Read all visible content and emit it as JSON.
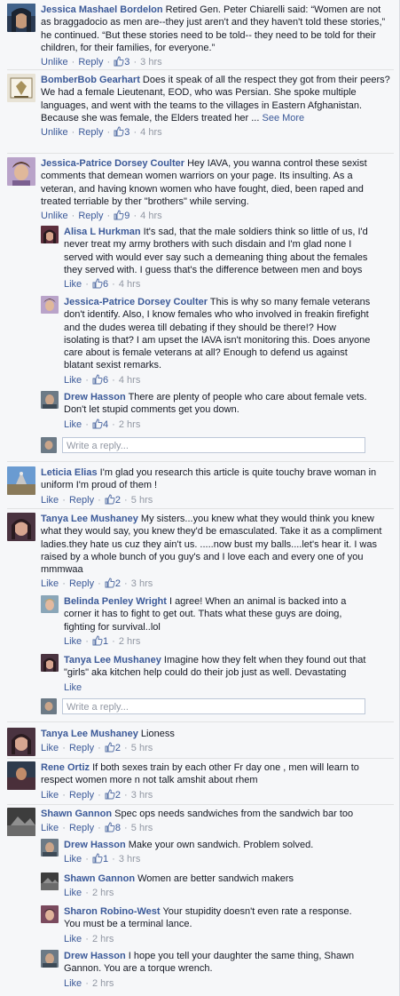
{
  "reply_placeholder": "Write a reply...",
  "see_more_label": "See More",
  "colors": {
    "link": "#3b5998",
    "meta": "#9197a3",
    "text": "#141823",
    "panel": "#f6f7f9"
  },
  "comments": [
    {
      "name": "Jessica Mashael Bordelon",
      "text": "Retired Gen. Peter Chiarelli said: “Women are not as braggadocio as men are--they just aren't and they haven't told these stories,” he continued. “But these stories need to be told-- they need to be told for their children, for their families, for everyone.”",
      "action1": "Unlike",
      "reply": "Reply",
      "likes": "3",
      "time": "3 hrs"
    },
    {
      "name": "BomberBob Gearhart",
      "text": "Does it speak of all the respect they got from their peers? We had a female Lieutenant, EOD, who was Persian. She spoke multiple languages, and went with the teams to the villages in Eastern Afghanistan. Because she was female, the Elders treated her ...",
      "action1": "Unlike",
      "reply": "Reply",
      "likes": "3",
      "time": "4 hrs"
    },
    {
      "name": "Jessica-Patrice Dorsey Coulter",
      "text": "Hey IAVA, you wanna control these sexist comments that demean women warriors on your page. Its insulting. As a veteran, and having known women who have fought, died, been raped and treated terriable by ther \"brothers\" while serving.",
      "action1": "Unlike",
      "reply": "Reply",
      "likes": "9",
      "time": "4 hrs"
    },
    {
      "name": "Alisa L Hurkman",
      "text": "It's sad, that the male soldiers think so little of us, I'd never treat my army brothers with such disdain and I'm glad none I served with would ever say such a demeaning thing about the females they served with. I guess that's the difference between men and boys",
      "action1": "Like",
      "likes": "6",
      "time": "4 hrs"
    },
    {
      "name": "Jessica-Patrice Dorsey Coulter",
      "text": "This is why so many female veterans don't identify. Also, I know females who who involved in freakin firefight and the dudes werea till debating if they should be there!? How isolating is that? I am upset the IAVA isn't monitoring this. Does anyone care about is female veterans at all? Enough to defend us against blatant sexist remarks.",
      "action1": "Like",
      "likes": "6",
      "time": "4 hrs"
    },
    {
      "name": "Drew Hasson",
      "text": "There are plenty of people who care about female vets. Don't let stupid comments get you down.",
      "action1": "Like",
      "likes": "4",
      "time": "2 hrs"
    },
    {
      "name": "Leticia Elias",
      "text": "I'm glad you research this article is quite touchy brave woman in uniform I'm proud of them !",
      "action1": "Like",
      "reply": "Reply",
      "likes": "2",
      "time": "5 hrs"
    },
    {
      "name": "Tanya Lee Mushaney",
      "text": "My sisters...you knew what they would think you knew what they would say, you knew they'd be emasculated. Take it as a compliment ladies.they hate us cuz they ain't us. .....now bust my balls....let's hear it. I was raised by a whole bunch of you guy's and I love each and every one of you mmmwaa",
      "action1": "Like",
      "reply": "Reply",
      "likes": "2",
      "time": "3 hrs"
    },
    {
      "name": "Belinda Penley Wright",
      "text": "I agree! When an animal is backed into a corner it has to fight to get out. Thats what these guys are doing, fighting for survival..lol",
      "action1": "Like",
      "likes": "1",
      "time": "2 hrs"
    },
    {
      "name": "Tanya Lee Mushaney",
      "text": "Imagine how they felt when they found out that \"girls\" aka kitchen help could do their job just as well. Devastating",
      "action1": "Like"
    },
    {
      "name": "Tanya Lee Mushaney",
      "text": "Lioness",
      "action1": "Like",
      "reply": "Reply",
      "likes": "2",
      "time": "5 hrs"
    },
    {
      "name": "Rene Ortiz",
      "text": "If both sexes train by each other Fr day one , men will learn to respect women more n not talk amshit about rhem",
      "action1": "Like",
      "reply": "Reply",
      "likes": "2",
      "time": "3 hrs"
    },
    {
      "name": "Shawn Gannon",
      "text": "Spec ops needs sandwiches from the sandwich bar too",
      "action1": "Like",
      "reply": "Reply",
      "likes": "8",
      "time": "5 hrs"
    },
    {
      "name": "Drew Hasson",
      "text": "Make your own sandwich. Problem solved.",
      "action1": "Like",
      "likes": "1",
      "time": "3 hrs"
    },
    {
      "name": "Shawn Gannon",
      "text": "Women are better sandwich makers",
      "action1": "Like",
      "time": "2 hrs"
    },
    {
      "name": "Sharon Robino-West",
      "text": "Your stupidity doesn't even rate a response. You must be a terminal lance.",
      "action1": "Like",
      "time": "2 hrs"
    },
    {
      "name": "Drew Hasson",
      "text": "I hope you tell your daughter the same thing, Shawn Gannon. You are a torque wrench.",
      "action1": "Like",
      "time": "2 hrs"
    }
  ]
}
